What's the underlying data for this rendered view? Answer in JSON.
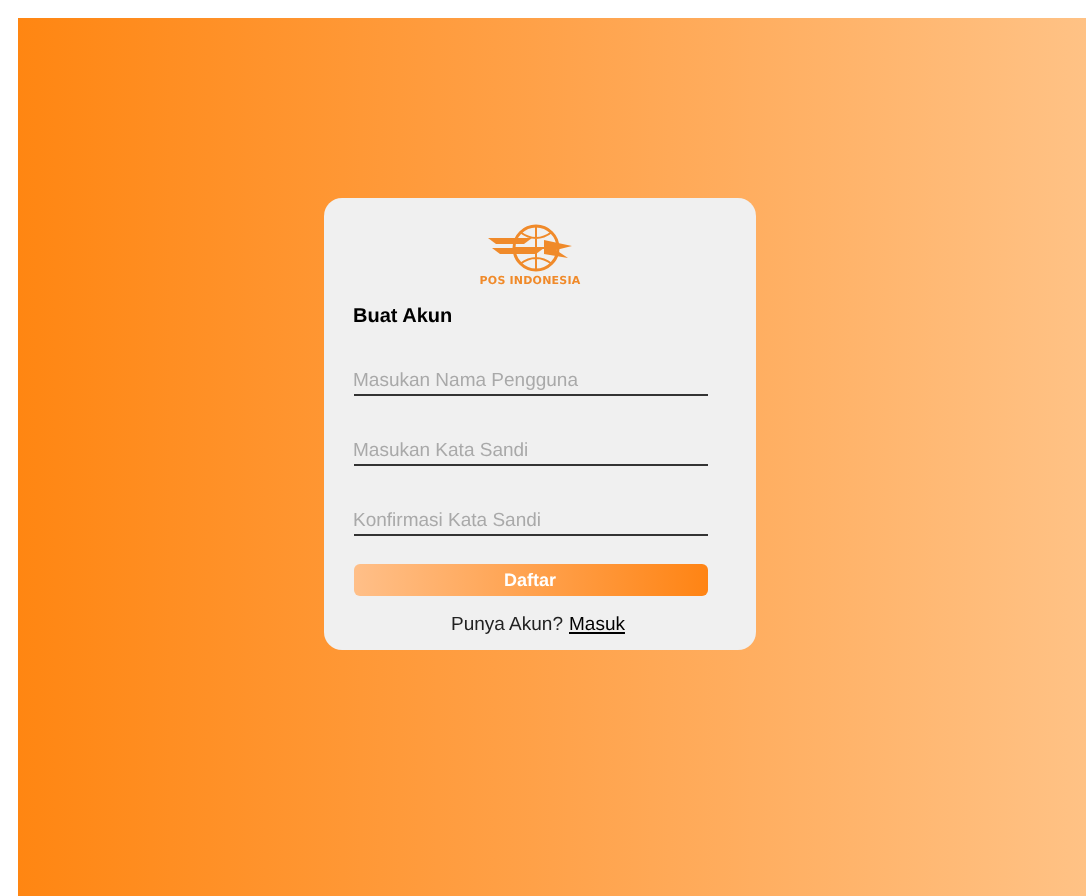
{
  "logo": {
    "text": "POS INDONESIA"
  },
  "form": {
    "title": "Buat Akun",
    "fields": [
      {
        "placeholder": "Masukan Nama Pengguna"
      },
      {
        "placeholder": "Masukan Kata Sandi"
      },
      {
        "placeholder": "Konfirmasi Kata Sandi"
      }
    ],
    "submit": "Daftar",
    "footer": {
      "text": "Punya Akun?",
      "link": "Masuk"
    }
  }
}
